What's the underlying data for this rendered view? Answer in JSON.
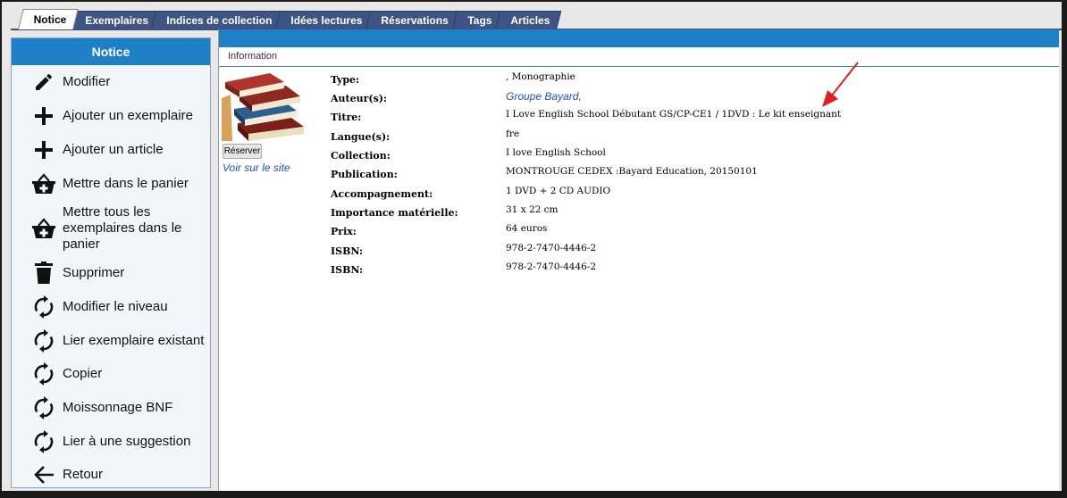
{
  "tabs": [
    {
      "label": "Notice",
      "active": true
    },
    {
      "label": "Exemplaires"
    },
    {
      "label": "Indices de collection"
    },
    {
      "label": "Idées lectures"
    },
    {
      "label": "Réservations"
    },
    {
      "label": "Tags"
    },
    {
      "label": "Articles"
    }
  ],
  "sidebar": {
    "title": "Notice",
    "items": [
      {
        "label": "Modifier",
        "icon": "pencil-icon"
      },
      {
        "label": "Ajouter un exemplaire",
        "icon": "plus-icon"
      },
      {
        "label": "Ajouter un article",
        "icon": "plus-icon"
      },
      {
        "label": "Mettre dans le panier",
        "icon": "basket-add-icon"
      },
      {
        "label": "Mettre tous les exemplaires dans le panier",
        "icon": "basket-add-icon"
      },
      {
        "label": "Supprimer",
        "icon": "trash-icon"
      },
      {
        "label": "Modifier le niveau",
        "icon": "refresh-icon"
      },
      {
        "label": "Lier exemplaire existant",
        "icon": "refresh-icon"
      },
      {
        "label": "Copier",
        "icon": "refresh-icon"
      },
      {
        "label": "Moissonnage BNF",
        "icon": "refresh-icon"
      },
      {
        "label": "Lier à une suggestion",
        "icon": "refresh-icon"
      },
      {
        "label": "Retour",
        "icon": "arrow-left-icon"
      }
    ]
  },
  "section": {
    "title": "Information"
  },
  "cover": {
    "reserve_label": "Réserver",
    "site_link": "Voir sur le site"
  },
  "fields": [
    {
      "key": "Type:",
      "value": ", Monographie"
    },
    {
      "key": "Auteur(s):",
      "value": "Groupe Bayard,",
      "link": true
    },
    {
      "key": "Titre:",
      "value": "I Love English School Débutant GS/CP-CE1 / 1DVD : Le kit enseignant"
    },
    {
      "key": "Langue(s):",
      "value": "fre"
    },
    {
      "key": "Collection:",
      "value": "I love English School"
    },
    {
      "key": "Publication:",
      "value": "MONTROUGE CEDEX :Bayard Education, 20150101"
    },
    {
      "key": "Accompagnement:",
      "value": "1 DVD + 2 CD AUDIO"
    },
    {
      "key": "Importance matérielle:",
      "value": "31 x 22 cm"
    },
    {
      "key": "Prix:",
      "value": "64 euros"
    },
    {
      "key": "ISBN:",
      "value": "978-2-7470-4446-2"
    },
    {
      "key": "ISBN:",
      "value": "978-2-7470-4446-2"
    }
  ],
  "colors": {
    "accent": "#1f80c8",
    "tab": "#3e5584",
    "link": "#1f50c8",
    "annotation": "#e02020"
  }
}
